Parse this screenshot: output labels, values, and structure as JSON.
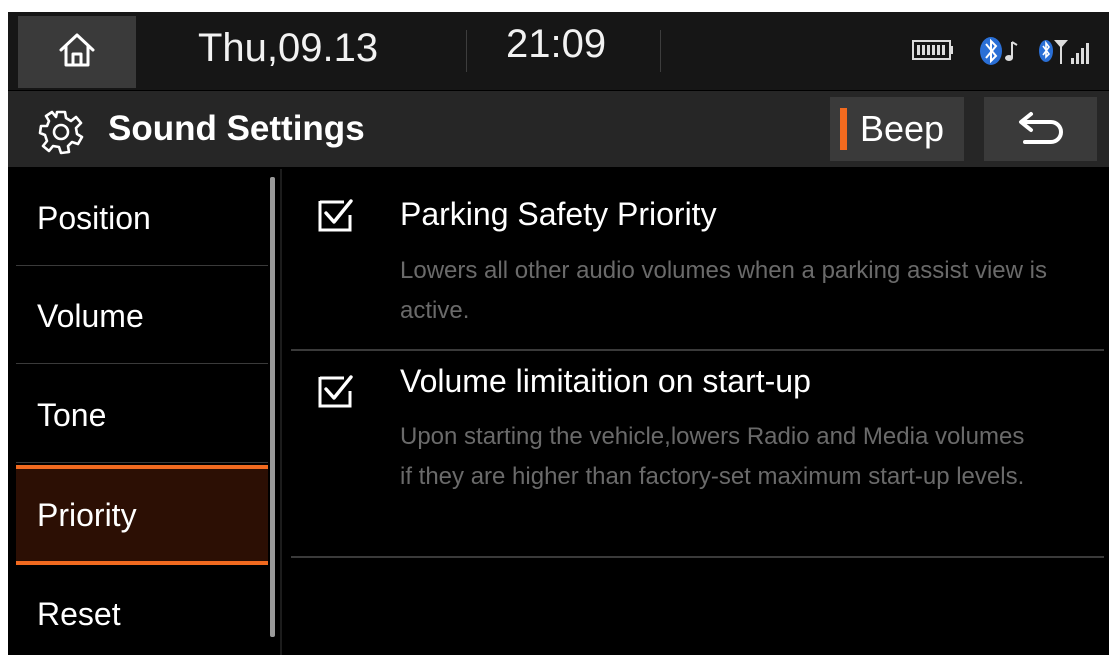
{
  "status_bar": {
    "date": "Thu,09.13",
    "time": "21:09",
    "icons": [
      "home-icon",
      "battery-icon",
      "bluetooth-audio-icon",
      "bluetooth-signal-icon"
    ]
  },
  "header": {
    "title": "Sound Settings",
    "beep_label": "Beep",
    "accent_color": "#f26a1f"
  },
  "menu": {
    "items": [
      {
        "label": "Position"
      },
      {
        "label": "Volume"
      },
      {
        "label": "Tone"
      },
      {
        "label": "Priority",
        "active": true
      },
      {
        "label": "Reset"
      }
    ]
  },
  "options": [
    {
      "title": "Parking Safety Priority",
      "description": "Lowers all other audio volumes when a parking assist view is active.",
      "checked": true
    },
    {
      "title": "Volume limitaition on start-up",
      "description": "Upon starting the vehicle,lowers Radio and Media volumes if they are higher than factory-set maximum start-up levels.",
      "checked": true
    }
  ]
}
